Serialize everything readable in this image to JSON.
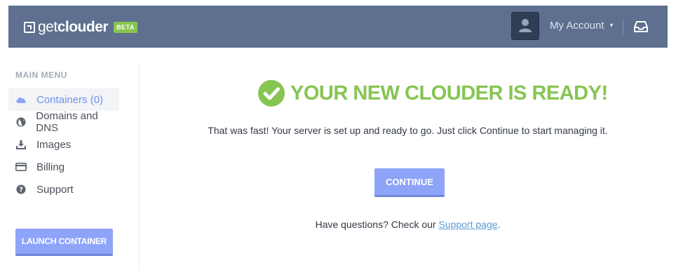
{
  "header": {
    "logo_text_light": "get",
    "logo_text_bold": "clouder",
    "beta_badge": "BETA",
    "account_label": "My Account",
    "account_caret": "⌄",
    "inbox_icon": "inbox-icon",
    "avatar_icon": "user-icon"
  },
  "sidebar": {
    "title": "MAIN MENU",
    "items": [
      {
        "label": "Containers (0)",
        "icon": "cloud-icon",
        "active": true
      },
      {
        "label": "Domains and DNS",
        "icon": "globe-icon",
        "active": false
      },
      {
        "label": "Images",
        "icon": "download-icon",
        "active": false
      },
      {
        "label": "Billing",
        "icon": "credit-card-icon",
        "active": false
      },
      {
        "label": "Support",
        "icon": "question-icon",
        "active": false
      }
    ],
    "launch_button": "LAUNCH CONTAINER"
  },
  "main": {
    "ready_title": "YOUR NEW CLOUDER IS READY!",
    "message": "That was fast! Your server is set up and ready to go. Just click Continue to start managing it.",
    "continue_button": "CONTINUE",
    "questions_prefix": "Have questions? Check our ",
    "support_link": "Support page",
    "questions_suffix": "."
  },
  "colors": {
    "topbar": "#5e6f8f",
    "accent_green": "#86c551",
    "button_blue": "#8ea4f9",
    "active_item": "#6e8ef7",
    "link": "#5b9bd5"
  }
}
